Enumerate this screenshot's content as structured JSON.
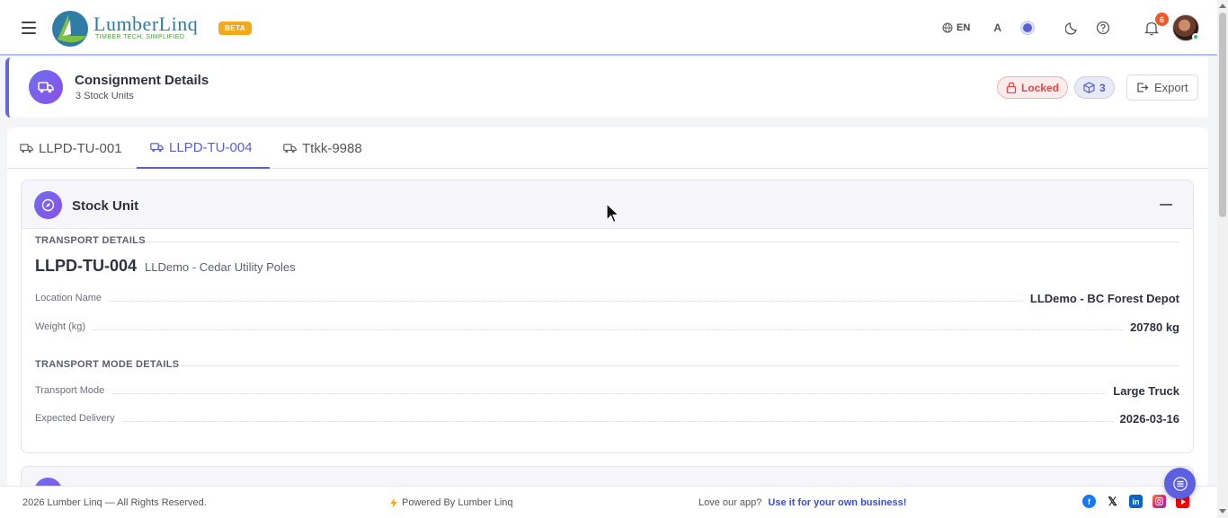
{
  "header": {
    "logo_text": "LumberLinq",
    "logo_tagline": "TIMBER TECH, SIMPLIFIED",
    "beta_label": "BETA",
    "language": "EN",
    "font_size_label": "A",
    "notification_count": "6"
  },
  "consignment": {
    "title": "Consignment Details",
    "subtitle": "3 Stock Units",
    "locked_label": "Locked",
    "units_count": "3",
    "export_label": "Export"
  },
  "tabs": [
    {
      "label": "LLPD-TU-001",
      "active": false
    },
    {
      "label": "LLPD-TU-004",
      "active": true
    },
    {
      "label": "Ttkk-9988",
      "active": false
    }
  ],
  "stock_unit": {
    "title": "Stock Unit",
    "transport_section": "TRANSPORT DETAILS",
    "unit_id": "LLPD-TU-004",
    "unit_name": "LLDemo - Cedar Utility Poles",
    "location_label": "Location Name",
    "location_value": "LLDemo - BC Forest Depot",
    "weight_label": "Weight (kg)",
    "weight_value": "20780 kg",
    "mode_section": "TRANSPORT MODE DETAILS",
    "mode_label": "Transport Mode",
    "mode_value": "Large Truck",
    "delivery_label": "Expected Delivery",
    "delivery_value": "2026-03-16"
  },
  "footer": {
    "copyright": "2026 Lumber Linq — All Rights Reserved.",
    "powered": "Powered By Lumber Linq",
    "love_text": "Love our app?",
    "love_link": "Use it for your own business!"
  },
  "colors": {
    "accent": "#5b5fd6",
    "locked": "#e04848",
    "notification": "#f05a28",
    "beta": "#f4a81b"
  }
}
